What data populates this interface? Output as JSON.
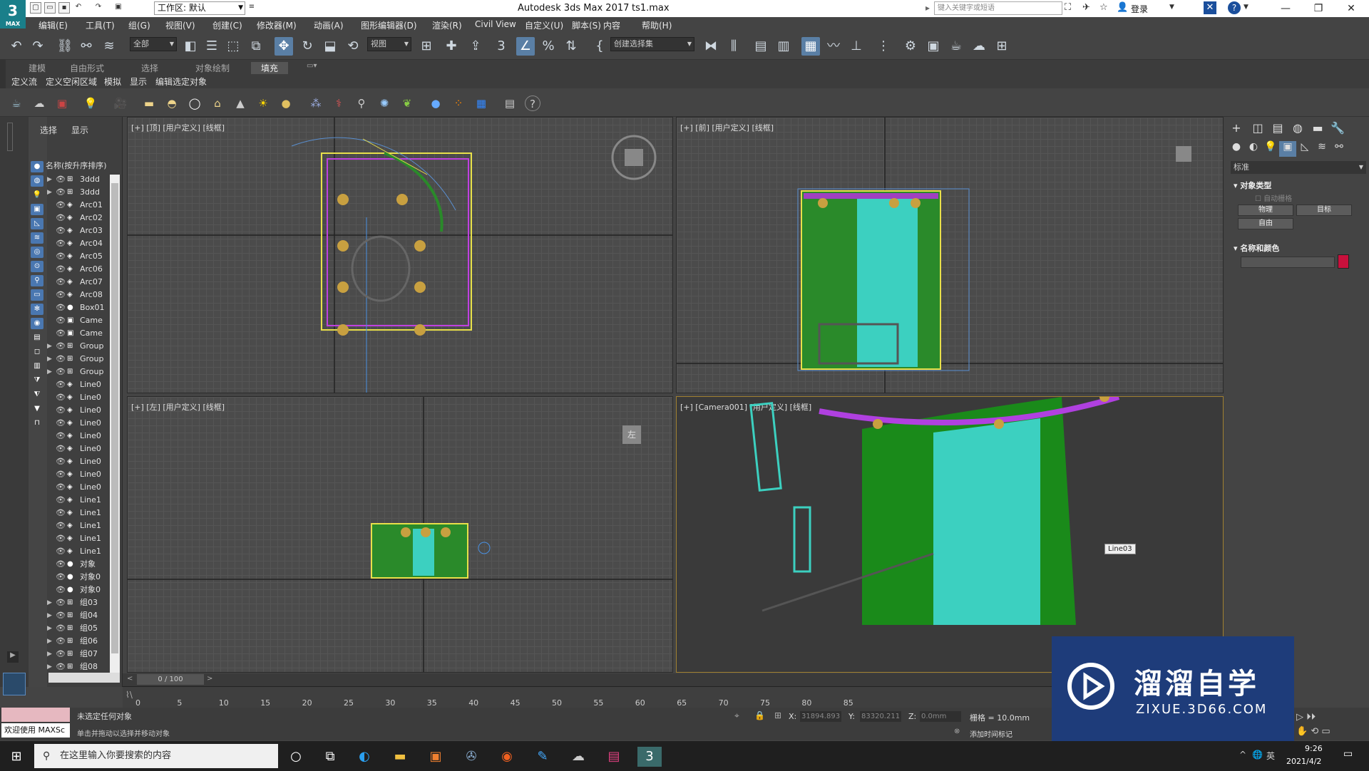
{
  "titlebar": {
    "logo_text": "3",
    "logo_sub": "MAX",
    "workspace": "工作区: 默认",
    "app_title": "Autodesk 3ds Max 2017",
    "file_name": "ts1.max",
    "search_placeholder": "键入关键字或短语",
    "login": "登录",
    "help": "?"
  },
  "menus": [
    "编辑(E)",
    "工具(T)",
    "组(G)",
    "视图(V)",
    "创建(C)",
    "修改器(M)",
    "动画(A)",
    "图形编辑器(D)",
    "渲染(R)",
    "Civil View",
    "自定义(U)",
    "脚本(S)",
    "内容",
    "帮助(H)"
  ],
  "toolbar": {
    "selection_filter": "全部",
    "ref_coord": "视图",
    "named_selection": "创建选择集"
  },
  "ribbon": {
    "tabs": [
      "建模",
      "自由形式",
      "选择",
      "对象绘制",
      "填充"
    ],
    "active_tab": "填充",
    "subitems": [
      "定义流",
      "定义空闲区域",
      "模拟",
      "显示",
      "编辑选定对象"
    ]
  },
  "scene_explorer": {
    "tabs": [
      "选择",
      "显示"
    ],
    "column": "名称(按升序排序)",
    "rows": [
      {
        "name": "3ddd",
        "type": "group",
        "exp": true
      },
      {
        "name": "3ddd",
        "type": "group",
        "exp": true
      },
      {
        "name": "Arc01",
        "type": "shape",
        "exp": false
      },
      {
        "name": "Arc02",
        "type": "shape",
        "exp": false
      },
      {
        "name": "Arc03",
        "type": "shape",
        "exp": false
      },
      {
        "name": "Arc04",
        "type": "shape",
        "exp": false
      },
      {
        "name": "Arc05",
        "type": "shape",
        "exp": false
      },
      {
        "name": "Arc06",
        "type": "shape",
        "exp": false
      },
      {
        "name": "Arc07",
        "type": "shape",
        "exp": false
      },
      {
        "name": "Arc08",
        "type": "shape",
        "exp": false
      },
      {
        "name": "Box01",
        "type": "geo",
        "exp": false
      },
      {
        "name": "Came",
        "type": "cam",
        "exp": false
      },
      {
        "name": "Came",
        "type": "cam",
        "exp": false
      },
      {
        "name": "Group",
        "type": "group",
        "exp": true
      },
      {
        "name": "Group",
        "type": "group",
        "exp": true
      },
      {
        "name": "Group",
        "type": "group",
        "exp": true
      },
      {
        "name": "Line0",
        "type": "shape",
        "exp": false
      },
      {
        "name": "Line0",
        "type": "shape",
        "exp": false
      },
      {
        "name": "Line0",
        "type": "shape",
        "exp": false
      },
      {
        "name": "Line0",
        "type": "shape",
        "exp": false
      },
      {
        "name": "Line0",
        "type": "shape",
        "exp": false
      },
      {
        "name": "Line0",
        "type": "shape",
        "exp": false
      },
      {
        "name": "Line0",
        "type": "shape",
        "exp": false
      },
      {
        "name": "Line0",
        "type": "shape",
        "exp": false
      },
      {
        "name": "Line0",
        "type": "shape",
        "exp": false
      },
      {
        "name": "Line1",
        "type": "shape",
        "exp": false
      },
      {
        "name": "Line1",
        "type": "shape",
        "exp": false
      },
      {
        "name": "Line1",
        "type": "shape",
        "exp": false
      },
      {
        "name": "Line1",
        "type": "shape",
        "exp": false
      },
      {
        "name": "Line1",
        "type": "shape",
        "exp": false
      },
      {
        "name": "对象",
        "type": "geo",
        "exp": false
      },
      {
        "name": "对象0",
        "type": "geo",
        "exp": false
      },
      {
        "name": "对象0",
        "type": "geo",
        "exp": false
      },
      {
        "name": "组03",
        "type": "group",
        "exp": true
      },
      {
        "name": "组04",
        "type": "group",
        "exp": true
      },
      {
        "name": "组05",
        "type": "group",
        "exp": true
      },
      {
        "name": "组06",
        "type": "group",
        "exp": true
      },
      {
        "name": "组07",
        "type": "group",
        "exp": true
      },
      {
        "name": "组08",
        "type": "group",
        "exp": true
      }
    ]
  },
  "viewports": {
    "top": "[+] [顶] [用户定义] [线框]",
    "front": "[+] [前] [用户定义] [线框]",
    "left": "[+] [左] [用户定义] [线框]",
    "camera": "[+] [Camera001] [用户定义] [线框]",
    "tooltip": "Line03",
    "viewcube_left": "左"
  },
  "command_panel": {
    "dropdown": "标准",
    "object_type": "对象类型",
    "auto_grid": "自动栅格",
    "buttons": [
      "物理",
      "目标",
      "自由"
    ],
    "name_color": "名称和颜色",
    "object_color": "#c8103c"
  },
  "timeline": {
    "frame": "0 / 100",
    "ticks": [
      "0",
      "5",
      "10",
      "15",
      "20",
      "25",
      "30",
      "35",
      "40",
      "45",
      "50",
      "55",
      "60",
      "65",
      "70",
      "75",
      "80",
      "85"
    ]
  },
  "status": {
    "maxscript": "欢迎使用 MAXSc",
    "line1": "未选定任何对象",
    "line2": "单击并拖动以选择并移动对象",
    "x_label": "X:",
    "x_value": "31894.893",
    "y_label": "Y:",
    "y_value": "83320.211",
    "z_label": "Z:",
    "z_value": "0.0mm",
    "grid": "栅格 = 10.0mm",
    "add_time_tag": "添加时间标记"
  },
  "taskbar": {
    "search_placeholder": "在这里输入你要搜索的内容",
    "time": "9:26",
    "date": "2021/4/2",
    "lang": "英"
  },
  "watermark": {
    "brand": "溜溜自学",
    "url": "ZIXUE.3D66.COM"
  }
}
